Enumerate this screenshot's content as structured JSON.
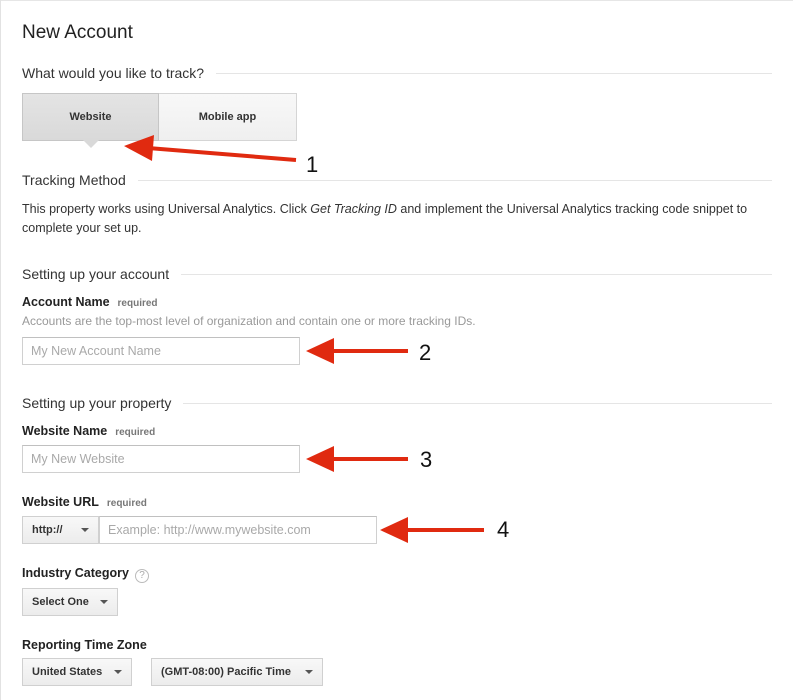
{
  "page": {
    "title": "New Account"
  },
  "track": {
    "heading": "What would you like to track?",
    "options": [
      {
        "label": "Website",
        "selected": true
      },
      {
        "label": "Mobile app",
        "selected": false
      }
    ]
  },
  "tracking_method": {
    "heading": "Tracking Method",
    "text_before": "This property works using Universal Analytics. Click ",
    "text_emphasis": "Get Tracking ID",
    "text_after": " and implement the Universal Analytics tracking code snippet to complete your set up."
  },
  "account": {
    "heading": "Setting up your account",
    "name_label": "Account Name",
    "required_label": "required",
    "hint": "Accounts are the top-most level of organization and contain one or more tracking IDs.",
    "name_placeholder": "My New Account Name",
    "name_value": ""
  },
  "property": {
    "heading": "Setting up your property",
    "website_name_label": "Website Name",
    "website_name_placeholder": "My New Website",
    "website_url_label": "Website URL",
    "protocol_value": "http://",
    "url_placeholder": "Example: http://www.mywebsite.com",
    "required_label": "required",
    "industry_label": "Industry Category",
    "industry_help": "?",
    "industry_value": "Select One",
    "timezone_label": "Reporting Time Zone",
    "country_value": "United States",
    "timezone_value": "(GMT-08:00) Pacific Time"
  },
  "annotations": {
    "n1": "1",
    "n2": "2",
    "n3": "3",
    "n4": "4",
    "arrow_color": "#e02a10"
  }
}
